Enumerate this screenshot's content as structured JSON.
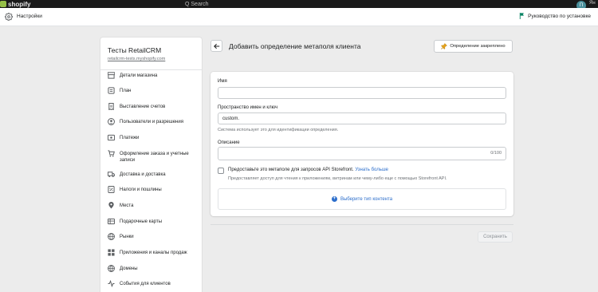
{
  "topbar": {
    "brand": "shopify",
    "search_fragment": "Q  Search",
    "avatar": "П",
    "user_fragment": "Ян"
  },
  "settings_bar": {
    "title": "Настройки",
    "guide_label": "Руководство по установке"
  },
  "sidebar": {
    "store_name": "Тесты RetailCRM",
    "store_url": "retailcrm-tests.myshopify.com",
    "items": [
      {
        "label": "Детали магазина",
        "icon": "store-icon"
      },
      {
        "label": "План",
        "icon": "plan-icon"
      },
      {
        "label": "Выставление счетов",
        "icon": "billing-icon"
      },
      {
        "label": "Пользователи и разрешения",
        "icon": "user-icon"
      },
      {
        "label": "Платежи",
        "icon": "payments-icon"
      },
      {
        "label": "Оформление заказа и учетные записи",
        "icon": "checkout-icon"
      },
      {
        "label": "Доставка и доставка",
        "icon": "shipping-icon"
      },
      {
        "label": "Налоги и пошлины",
        "icon": "taxes-icon"
      },
      {
        "label": "Места",
        "icon": "location-icon"
      },
      {
        "label": "Подарочные карты",
        "icon": "gift-card-icon"
      },
      {
        "label": "Рынки",
        "icon": "globe-icon"
      },
      {
        "label": "Приложения и каналы продаж",
        "icon": "apps-icon"
      },
      {
        "label": "Домены",
        "icon": "domain-icon"
      },
      {
        "label": "События для клиентов",
        "icon": "events-icon"
      }
    ]
  },
  "main": {
    "title": "Добавить определение метаполя клиента",
    "pin_label": "Определение закреплено",
    "form": {
      "name_label": "Имя",
      "name_value": "",
      "namespace_label": "Пространство имен и ключ",
      "namespace_value": "custom.",
      "namespace_help": "Система использует это для идентификации определения.",
      "description_label": "Описание",
      "description_value": "",
      "description_counter": "0/100",
      "storefront_label": "Предоставьте это метаполе для запросов API Storefront.",
      "storefront_link": "Узнать больше",
      "storefront_help": "Предоставляет доступ для чтения к приложениям, витринам или чему-либо еще с помощью Storefront API.",
      "content_type_label": "Выберите тип контента"
    },
    "save_label": "Сохранить"
  },
  "colors": {
    "accent": "#2c6ecb",
    "background": "#ececec",
    "card": "#ffffff"
  }
}
